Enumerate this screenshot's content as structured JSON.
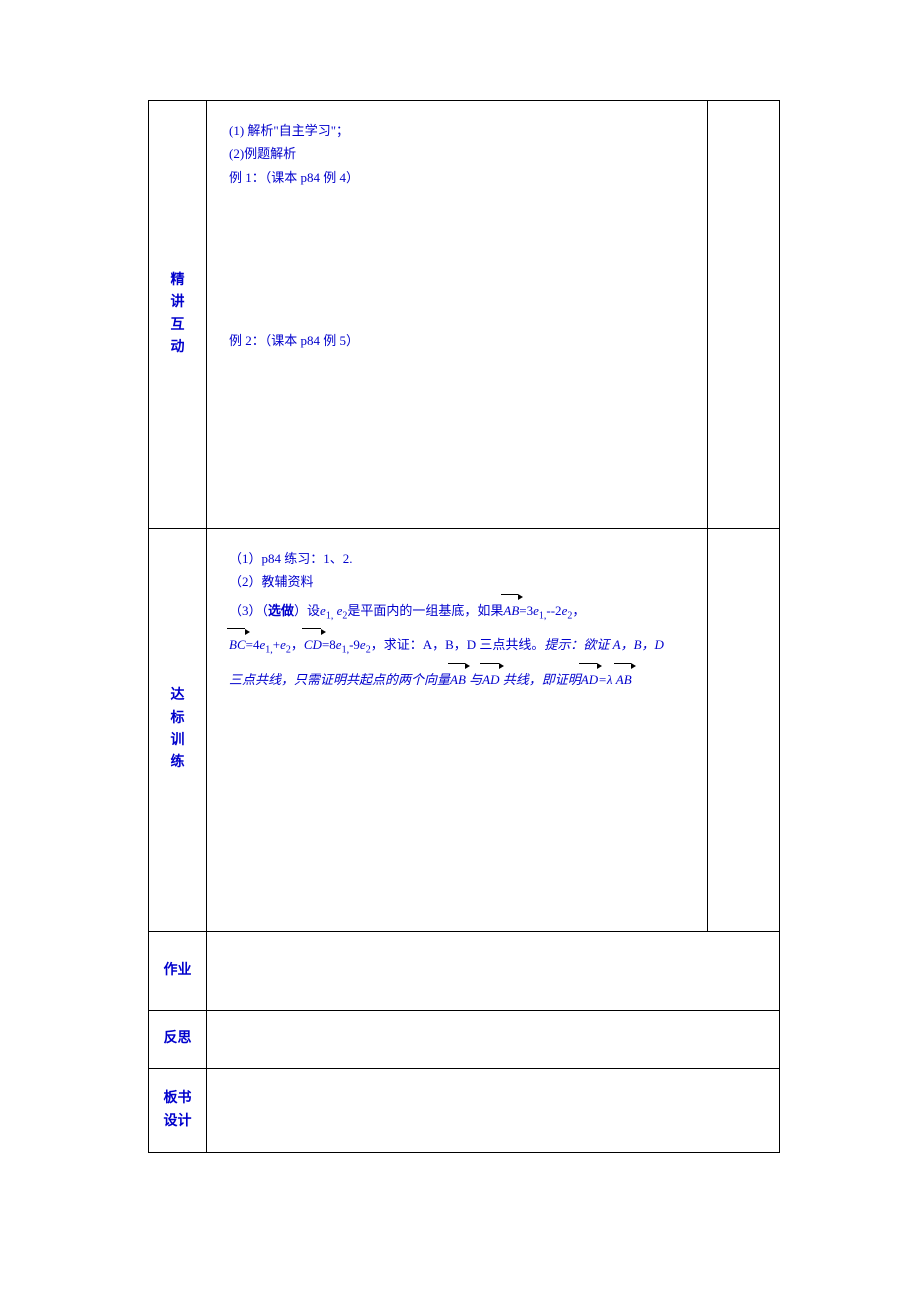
{
  "rows": {
    "r1": {
      "label_chars": [
        "精",
        "讲",
        "互",
        "动"
      ],
      "content": {
        "line1": "(1) 解析\"自主学习\"；",
        "line2": "(2)例题解析",
        "ex1": "例 1：（课本 p84 例 4）",
        "ex2": "例 2：（课本 p84 例 5）"
      }
    },
    "r2": {
      "label_chars": [
        "达",
        "标",
        "训",
        "练"
      ],
      "content": {
        "line1": "（1）p84 练习：1、2.",
        "line2": "（2）教辅资料",
        "line3_prefix": "（3）（",
        "line3_bold": "选做",
        "line3_mid1": "）设",
        "e1": "e",
        "sub1": "1,",
        "e2": "e",
        "sub2": "2",
        "line3_mid2": "是平面内的一组基底，如果",
        "vecAB": "AB",
        "eq1": "=3",
        "e1b": "e",
        "sub1b": "1,",
        "minus": "--2",
        "e2b": "e",
        "sub2b": "2",
        "comma": "，",
        "vecBC": "BC",
        "eq2": "=4",
        "e1c": "e",
        "sub1c": "1,",
        "plus": "+",
        "e2c": "e",
        "sub2c": "2",
        "comma2": "，",
        "vecCD": "CD",
        "eq3": "=8",
        "e1d": "e",
        "sub1d": "1,",
        "minus2": "-9",
        "e2d": "e",
        "sub2d": "2",
        "line3_end": "，求证：A，B，D 三点共线。",
        "hint_prefix": "提示：欲证 A，B，D",
        "hint_line2a": "三点共线，只需证明共起点的两个向量",
        "vecAB2": "AB",
        "hint_mid": " 与",
        "vecAD": "AD",
        "hint_mid2": " 共线，即证明",
        "vecAD2": "AD",
        "eqL": "=λ ",
        "vecAB3": "AB"
      }
    },
    "r3": {
      "label": "作业"
    },
    "r4": {
      "label": "反思"
    },
    "r5": {
      "label_line1": "板书",
      "label_line2": "设计"
    }
  }
}
